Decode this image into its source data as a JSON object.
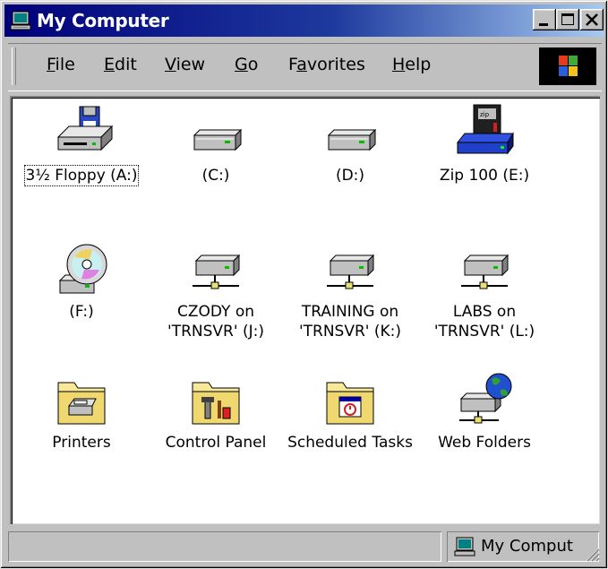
{
  "window": {
    "title": "My Computer"
  },
  "menu": [
    {
      "label": "File",
      "mnemonic": "F",
      "rest": "ile"
    },
    {
      "label": "Edit",
      "mnemonic": "E",
      "rest": "dit"
    },
    {
      "label": "View",
      "mnemonic": "V",
      "rest": "iew"
    },
    {
      "label": "Go",
      "mnemonic": "G",
      "rest": "o"
    },
    {
      "label": "Favorites",
      "pre": "F",
      "mnemonic": "a",
      "rest": "vorites"
    },
    {
      "label": "Help",
      "mnemonic": "H",
      "rest": "elp"
    }
  ],
  "items": [
    {
      "label": "3½ Floppy (A:)",
      "icon": "floppy-drive-icon"
    },
    {
      "label": "(C:)",
      "icon": "hard-drive-icon"
    },
    {
      "label": "(D:)",
      "icon": "hard-drive-icon"
    },
    {
      "label": "Zip 100 (E:)",
      "icon": "zip-drive-icon"
    },
    {
      "label": "(F:)",
      "icon": "cd-drive-icon"
    },
    {
      "label": "CZODY on 'TRNSVR' (J:)",
      "icon": "network-drive-icon"
    },
    {
      "label": "TRAINING on 'TRNSVR' (K:)",
      "icon": "network-drive-icon"
    },
    {
      "label": "LABS on 'TRNSVR' (L:)",
      "icon": "network-drive-icon"
    },
    {
      "label": "Printers",
      "icon": "printers-folder-icon"
    },
    {
      "label": "Control Panel",
      "icon": "control-panel-folder-icon"
    },
    {
      "label": "Scheduled Tasks",
      "icon": "scheduled-tasks-folder-icon"
    },
    {
      "label": "Web Folders",
      "icon": "web-folders-icon"
    }
  ],
  "status": {
    "left": "",
    "right": "My Comput"
  },
  "colors": {
    "titlebar_start": "#00007b",
    "titlebar_end": "#a6caf0",
    "face": "#c0c0c0"
  }
}
